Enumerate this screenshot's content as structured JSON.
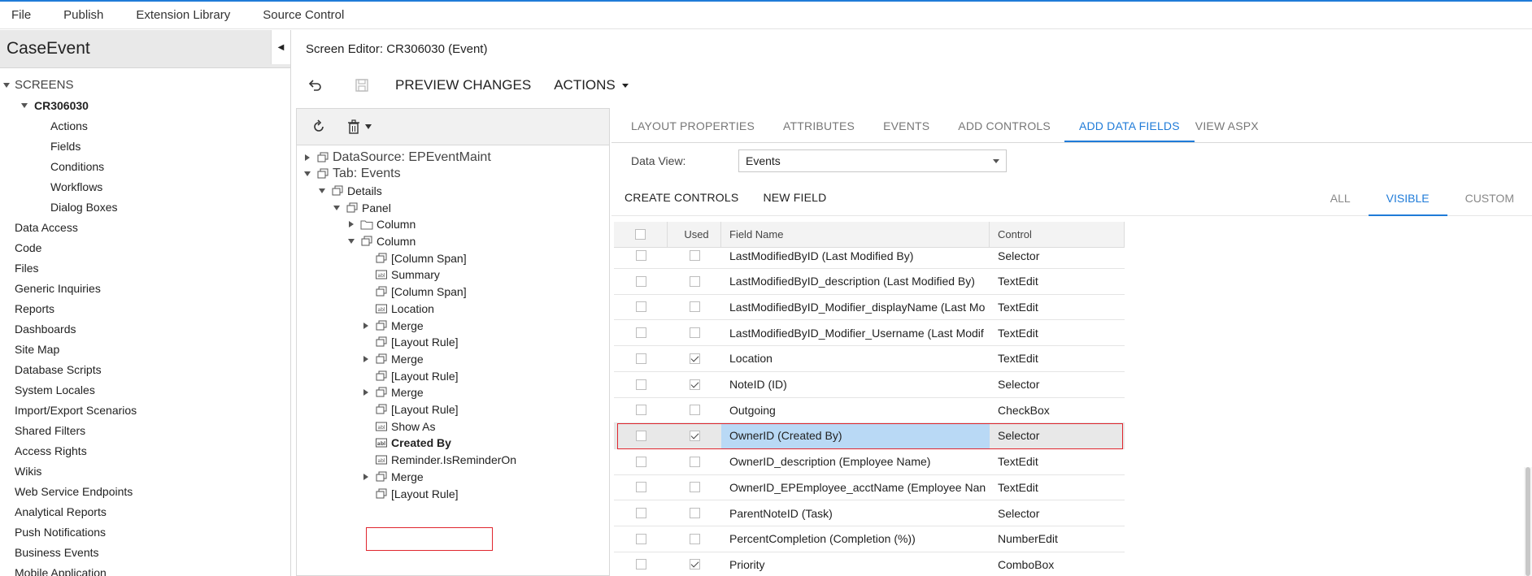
{
  "menubar": {
    "items": [
      "File",
      "Publish",
      "Extension Library",
      "Source Control"
    ]
  },
  "left": {
    "title": "CaseEvent",
    "screens_label": "SCREENS",
    "screen_id": "CR306030",
    "screen_children": [
      "Actions",
      "Fields",
      "Conditions",
      "Workflows",
      "Dialog Boxes"
    ],
    "sections": [
      "Data Access",
      "Code",
      "Files",
      "Generic Inquiries",
      "Reports",
      "Dashboards",
      "Site Map",
      "Database Scripts",
      "System Locales",
      "Import/Export Scenarios",
      "Shared Filters",
      "Access Rights",
      "Wikis",
      "Web Service Endpoints",
      "Analytical Reports",
      "Push Notifications",
      "Business Events",
      "Mobile Application"
    ]
  },
  "editor": {
    "title": "Screen Editor: CR306030 (Event)",
    "preview_label": "PREVIEW CHANGES",
    "actions_label": "ACTIONS"
  },
  "tree": {
    "nodes": [
      {
        "label": "DataSource: EPEventMaint",
        "level": 0,
        "toggle": "collapsed",
        "icon": "layers-icon",
        "big": true
      },
      {
        "label": "Tab: Events",
        "level": 0,
        "toggle": "expanded",
        "icon": "layers-icon",
        "big": true
      },
      {
        "label": "Details",
        "level": 1,
        "toggle": "expanded",
        "icon": "layers-icon"
      },
      {
        "label": "Panel",
        "level": 2,
        "toggle": "expanded",
        "icon": "layers-icon"
      },
      {
        "label": "Column",
        "level": 3,
        "toggle": "collapsed",
        "icon": "folder-icon"
      },
      {
        "label": "Column",
        "level": 3,
        "toggle": "expanded",
        "icon": "layers-icon"
      },
      {
        "label": "[Column Span]",
        "level": 4,
        "toggle": "none",
        "icon": "layers-icon"
      },
      {
        "label": "Summary",
        "level": 4,
        "toggle": "none",
        "icon": "textbox-icon"
      },
      {
        "label": "[Column Span]",
        "level": 4,
        "toggle": "none",
        "icon": "layers-icon"
      },
      {
        "label": "Location",
        "level": 4,
        "toggle": "none",
        "icon": "textbox-icon"
      },
      {
        "label": "Merge",
        "level": 4,
        "toggle": "collapsed",
        "icon": "layers-icon"
      },
      {
        "label": "[Layout Rule]",
        "level": 4,
        "toggle": "none",
        "icon": "layers-icon"
      },
      {
        "label": "Merge",
        "level": 4,
        "toggle": "collapsed",
        "icon": "layers-icon"
      },
      {
        "label": "[Layout Rule]",
        "level": 4,
        "toggle": "none",
        "icon": "layers-icon"
      },
      {
        "label": "Merge",
        "level": 4,
        "toggle": "collapsed",
        "icon": "layers-icon"
      },
      {
        "label": "[Layout Rule]",
        "level": 4,
        "toggle": "none",
        "icon": "layers-icon"
      },
      {
        "label": "Show As",
        "level": 4,
        "toggle": "none",
        "icon": "textbox-icon"
      },
      {
        "label": "Created By",
        "level": 4,
        "toggle": "none",
        "icon": "textbox-icon",
        "bold": true
      },
      {
        "label": "Reminder.IsReminderOn",
        "level": 4,
        "toggle": "none",
        "icon": "textbox-icon"
      },
      {
        "label": "Merge",
        "level": 4,
        "toggle": "collapsed",
        "icon": "layers-icon"
      },
      {
        "label": "[Layout Rule]",
        "level": 4,
        "toggle": "none",
        "icon": "layers-icon"
      }
    ]
  },
  "right": {
    "tabs": [
      "LAYOUT PROPERTIES",
      "ATTRIBUTES",
      "EVENTS",
      "ADD CONTROLS",
      "ADD DATA FIELDS",
      "VIEW ASPX"
    ],
    "active_tab": "ADD DATA FIELDS",
    "data_view_label": "Data View:",
    "data_view_value": "Events",
    "create_controls_label": "CREATE CONTROLS",
    "new_field_label": "NEW FIELD",
    "filter_tabs": [
      "ALL",
      "VISIBLE",
      "CUSTOM"
    ],
    "active_filter": "VISIBLE",
    "grid": {
      "headers": [
        "Used",
        "Field Name",
        "Control"
      ],
      "rows": [
        {
          "used": false,
          "field": "LastModifiedByID (Last Modified By)",
          "control": "Selector"
        },
        {
          "used": false,
          "field": "LastModifiedByID_description (Last Modified By)",
          "control": "TextEdit"
        },
        {
          "used": false,
          "field": "LastModifiedByID_Modifier_displayName (Last Mo",
          "control": "TextEdit"
        },
        {
          "used": false,
          "field": "LastModifiedByID_Modifier_Username (Last Modif",
          "control": "TextEdit"
        },
        {
          "used": true,
          "field": "Location",
          "control": "TextEdit"
        },
        {
          "used": true,
          "field": "NoteID (ID)",
          "control": "Selector"
        },
        {
          "used": false,
          "field": "Outgoing",
          "control": "CheckBox"
        },
        {
          "used": true,
          "field": "OwnerID (Created By)",
          "control": "Selector",
          "selected": true
        },
        {
          "used": false,
          "field": "OwnerID_description (Employee Name)",
          "control": "TextEdit"
        },
        {
          "used": false,
          "field": "OwnerID_EPEmployee_acctName (Employee Nan",
          "control": "TextEdit"
        },
        {
          "used": false,
          "field": "ParentNoteID (Task)",
          "control": "Selector"
        },
        {
          "used": false,
          "field": "PercentCompletion (Completion (%))",
          "control": "NumberEdit"
        },
        {
          "used": true,
          "field": "Priority",
          "control": "ComboBox"
        }
      ]
    }
  },
  "colors": {
    "accent": "#1f7bd8",
    "highlight_border": "#e0262e",
    "selected_cell": "#b9d9f5"
  }
}
